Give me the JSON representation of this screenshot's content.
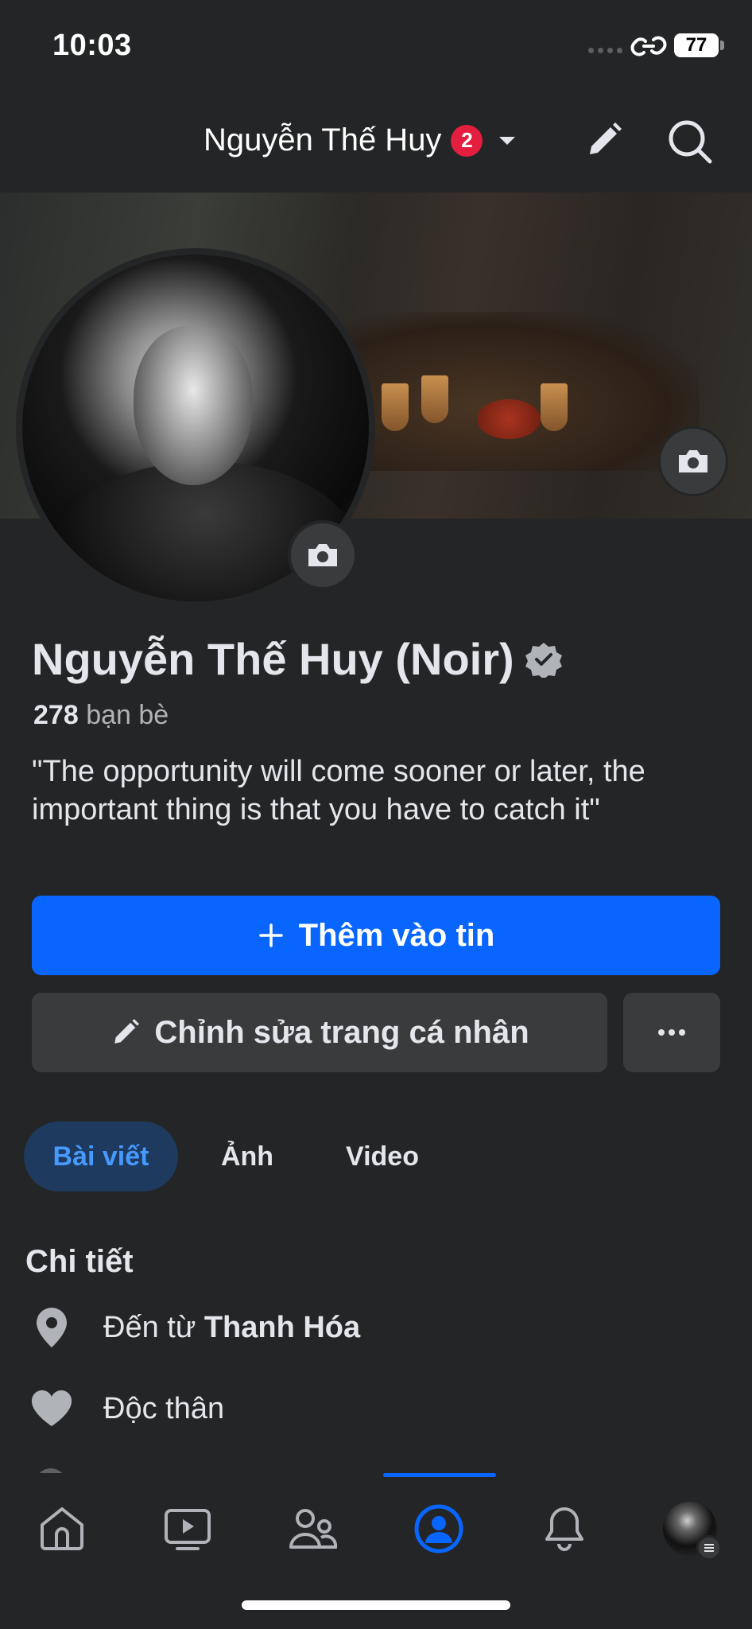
{
  "status_bar": {
    "time": "10:03",
    "battery": "77"
  },
  "header": {
    "title": "Nguyễn Thế Huy",
    "notification_count": "2"
  },
  "profile": {
    "name": "Nguyễn Thế Huy (Noir)",
    "friends_count": "278",
    "friends_label": "bạn bè",
    "bio": "\"The opportunity will come sooner or later, the important thing is that you have to catch it\""
  },
  "buttons": {
    "add_story_label": "Thêm vào tin",
    "edit_profile_label": "Chỉnh sửa trang cá nhân"
  },
  "tabs": [
    {
      "label": "Bài viết",
      "active": true
    },
    {
      "label": "Ảnh",
      "active": false
    },
    {
      "label": "Video",
      "active": false
    }
  ],
  "details": {
    "title": "Chi tiết",
    "hometown_prefix": "Đến từ",
    "hometown": "Thanh Hóa",
    "relationship": "Độc thân"
  },
  "bottom_nav": {
    "items": [
      "home-icon",
      "video-icon",
      "friends-icon",
      "profile-icon",
      "bell-icon",
      "menu-avatar"
    ],
    "active": "profile-icon"
  },
  "colors": {
    "background": "#242526",
    "accent": "#0866ff",
    "badge": "#e41e3f",
    "secondary_button": "#3a3b3c"
  }
}
